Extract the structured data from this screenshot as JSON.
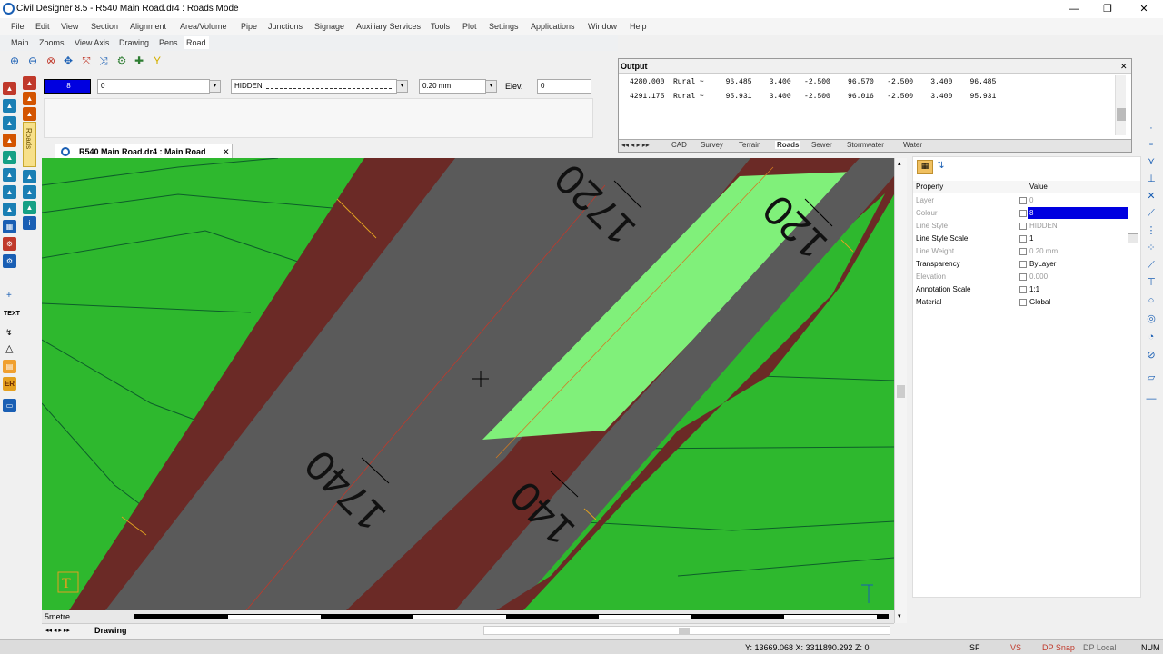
{
  "app": {
    "title": "Civil Designer 8.5 - R540 Main Road.dr4 : Roads Mode",
    "window_buttons": [
      "—",
      "❐",
      "✕"
    ]
  },
  "menu": [
    "File",
    "Edit",
    "View",
    "Section",
    "Alignment",
    "Area/Volume",
    "Pipe",
    "Junctions",
    "Signage",
    "Auxiliary Services",
    "Tools",
    "Plot",
    "Settings",
    "Applications",
    "Window",
    "Help"
  ],
  "ribbon_tabs": [
    "Main",
    "Zooms",
    "View Axis",
    "Drawing",
    "Pens",
    "Road"
  ],
  "properties_bar": {
    "colour_value": "8",
    "layer_value": "0",
    "linestyle_value": "HIDDEN",
    "lineweight_value": "0.20 mm",
    "elev_label": "Elev.",
    "elev_value": "0"
  },
  "left_tab_label": "Roads",
  "output": {
    "title": "Output",
    "close": "✕",
    "lines": [
      "4280.000  Rural ~     96.485    3.400   -2.500    96.570   -2.500    3.400    96.485",
      "4291.175  Rural ~     95.931    3.400   -2.500    96.016   -2.500    3.400    95.931"
    ],
    "tabs": [
      "CAD",
      "Survey",
      "Terrain",
      "Roads",
      "Sewer",
      "Stormwater",
      "Water"
    ],
    "active_tab": "Roads"
  },
  "document_tab": {
    "label": "R540 Main Road.dr4 : Main Road",
    "close": "✕"
  },
  "canvas": {
    "chainage_labels": [
      "1720",
      "120",
      "1740",
      "140"
    ],
    "scale_label": "5metre",
    "nav_label": "Drawing"
  },
  "property_panel": {
    "header_property": "Property",
    "header_value": "Value",
    "rows": [
      {
        "key": "Layer",
        "value": "0"
      },
      {
        "key": "Colour",
        "value": "8"
      },
      {
        "key": "Line Style",
        "value": "HIDDEN"
      },
      {
        "key": "Line Style Scale",
        "value": "1"
      },
      {
        "key": "Line Weight",
        "value": "0.20 mm"
      },
      {
        "key": "Transparency",
        "value": "ByLayer"
      },
      {
        "key": "Elevation",
        "value": "0.000"
      },
      {
        "key": "Annotation Scale",
        "value": "1:1"
      },
      {
        "key": "Material",
        "value": "Global"
      }
    ]
  },
  "statusbar": {
    "coords": "Y: 13669.068 X: 3311890.292 Z: 0",
    "items": [
      "SF",
      "VS",
      "DP Snap",
      "DP Local",
      "NUM"
    ]
  },
  "colors": {
    "grass": "#2eb82e",
    "road": "#5a5a5a",
    "shoulder": "#6b2a26",
    "island": "#80f07a",
    "colour_swatch": "#0000e0"
  }
}
